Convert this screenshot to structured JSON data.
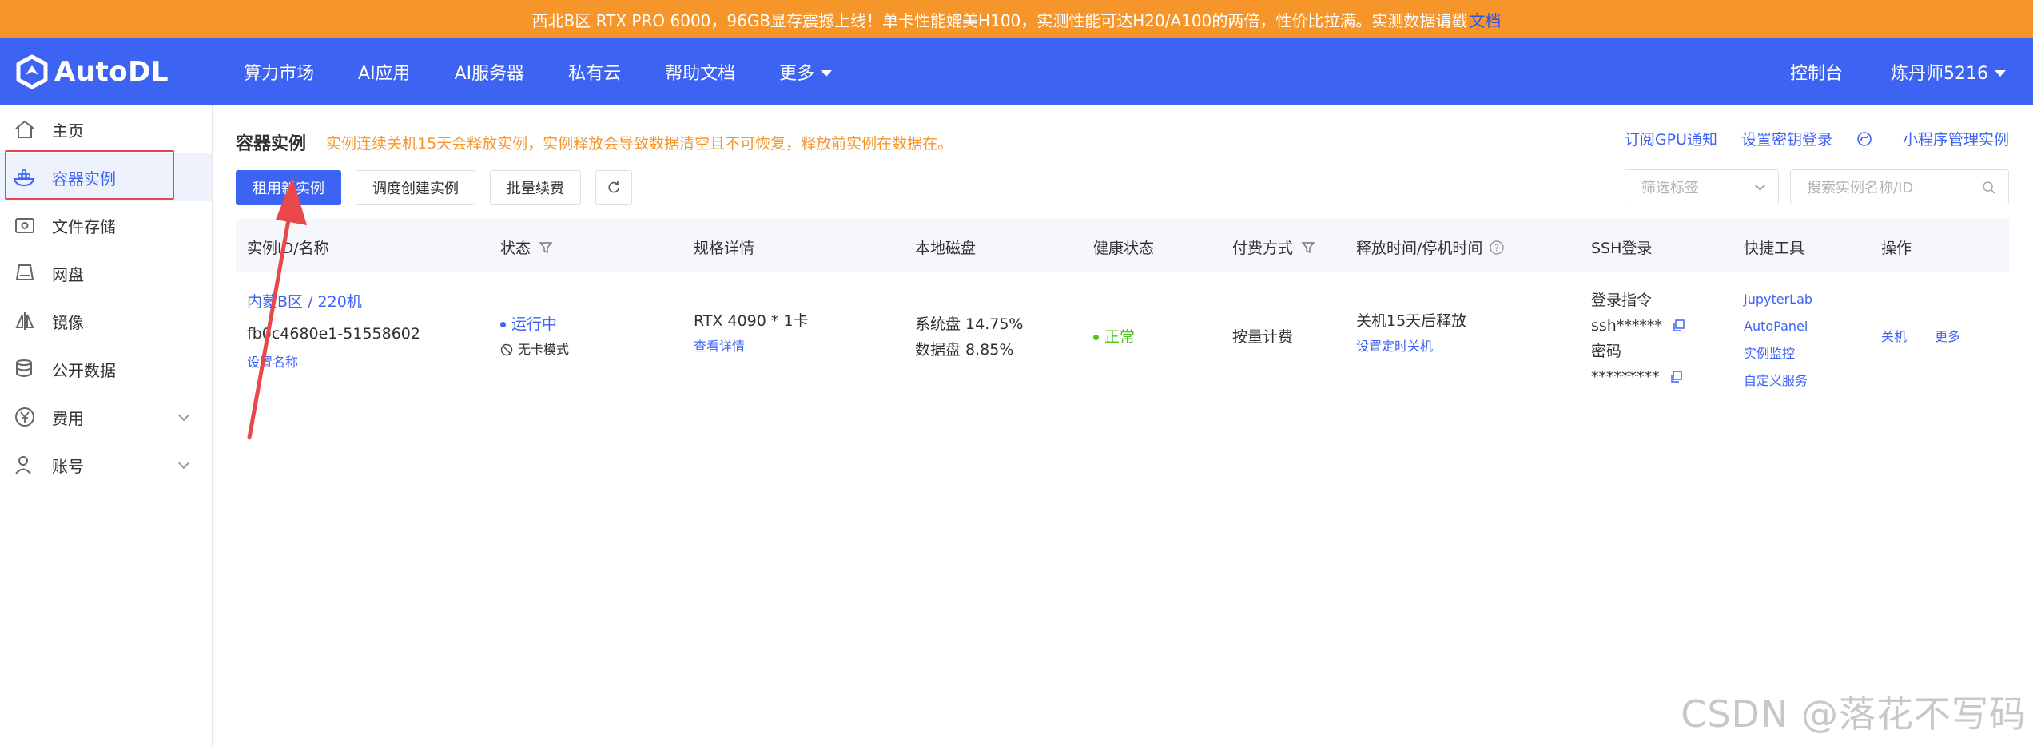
{
  "announcement": {
    "text": "西北B区 RTX PRO 6000，96GB显存震撼上线！单卡性能媲美H100，实测性能可达H20/A100的两倍，性价比拉满。实测数据请戳",
    "link": "文档"
  },
  "navbar": {
    "logo_text": "AutoDL",
    "items": [
      "算力市场",
      "AI应用",
      "AI服务器",
      "私有云",
      "帮助文档",
      "更多"
    ],
    "console": "控制台",
    "user": "炼丹师5216"
  },
  "sidebar": {
    "items": [
      {
        "label": "主页",
        "icon": "home-icon"
      },
      {
        "label": "容器实例",
        "icon": "container-icon"
      },
      {
        "label": "文件存储",
        "icon": "storage-icon"
      },
      {
        "label": "网盘",
        "icon": "disk-icon"
      },
      {
        "label": "镜像",
        "icon": "image-icon"
      },
      {
        "label": "公开数据",
        "icon": "database-icon"
      },
      {
        "label": "费用",
        "icon": "yuan-icon"
      },
      {
        "label": "账号",
        "icon": "user-icon"
      }
    ]
  },
  "page": {
    "title": "容器实例",
    "warning": "实例连续关机15天会释放实例，实例释放会导致数据清空且不可恢复，释放前实例在数据在。",
    "links": [
      "订阅GPU通知",
      "设置密钥登录",
      "小程序管理实例"
    ]
  },
  "toolbar": {
    "rent_new": "租用新实例",
    "schedule_create": "调度创建实例",
    "batch_renew": "批量续费",
    "filter_tag_placeholder": "筛选标签",
    "search_placeholder": "搜索实例名称/ID"
  },
  "table": {
    "headers": [
      "实例ID/名称",
      "状态",
      "规格详情",
      "本地磁盘",
      "健康状态",
      "付费方式",
      "释放时间/停机时间",
      "SSH登录",
      "快捷工具",
      "操作"
    ],
    "row": {
      "region_name": "内蒙B区 / 220机",
      "instance_id": "fb0c4680e1-51558602",
      "set_name": "设置名称",
      "status": "运行中",
      "mode": "无卡模式",
      "spec": "RTX 4090 * 1卡",
      "spec_detail": "查看详情",
      "sys_disk": "系统盘 14.75%",
      "data_disk": "数据盘 8.85%",
      "health": "正常",
      "billing": "按量计费",
      "release": "关机15天后释放",
      "set_timer": "设置定时关机",
      "ssh_label": "登录指令",
      "ssh_cmd": "ssh******",
      "pwd_label": "密码",
      "pwd": "*********",
      "tools": [
        "JupyterLab",
        "AutoPanel",
        "实例监控",
        "自定义服务"
      ],
      "ops_shutdown": "关机",
      "ops_more": "更多"
    }
  },
  "watermark": "CSDN @落花不写码",
  "colors": {
    "brand": "#3d63f2",
    "announce": "#f5952a",
    "success": "#52c41a",
    "highlight": "#e8474b"
  }
}
